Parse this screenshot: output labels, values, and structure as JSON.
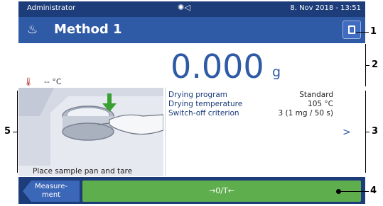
{
  "status_bar": {
    "user": "Administrator",
    "datetime": "8. Nov 2018 - 13:51",
    "icons": [
      "brightness-icon",
      "speaker-icon"
    ]
  },
  "header": {
    "method_icon": "steam-icon",
    "title": "Method 1",
    "home_icon": "home-icon"
  },
  "weight": {
    "value": "0.000",
    "unit": "g",
    "temperature": "-- °C",
    "thermo_icon": "thermometer-icon"
  },
  "instruction": {
    "text": "Place sample pan and tare"
  },
  "info": {
    "rows": [
      {
        "label": "Drying program",
        "value": "Standard"
      },
      {
        "label": "Drying temperature",
        "value": "105 °C"
      },
      {
        "label": "Switch-off criterion",
        "value": "3  (1 mg / 50 s)"
      }
    ],
    "more_glyph": ">"
  },
  "footer": {
    "measurement_label": "Measure-\nment",
    "tare_label": "→0/T←"
  },
  "callouts": [
    "1",
    "2",
    "3",
    "4",
    "5"
  ],
  "colors": {
    "navy": "#1c3d7a",
    "blue": "#2f5aa5",
    "green": "#5fae4e"
  }
}
